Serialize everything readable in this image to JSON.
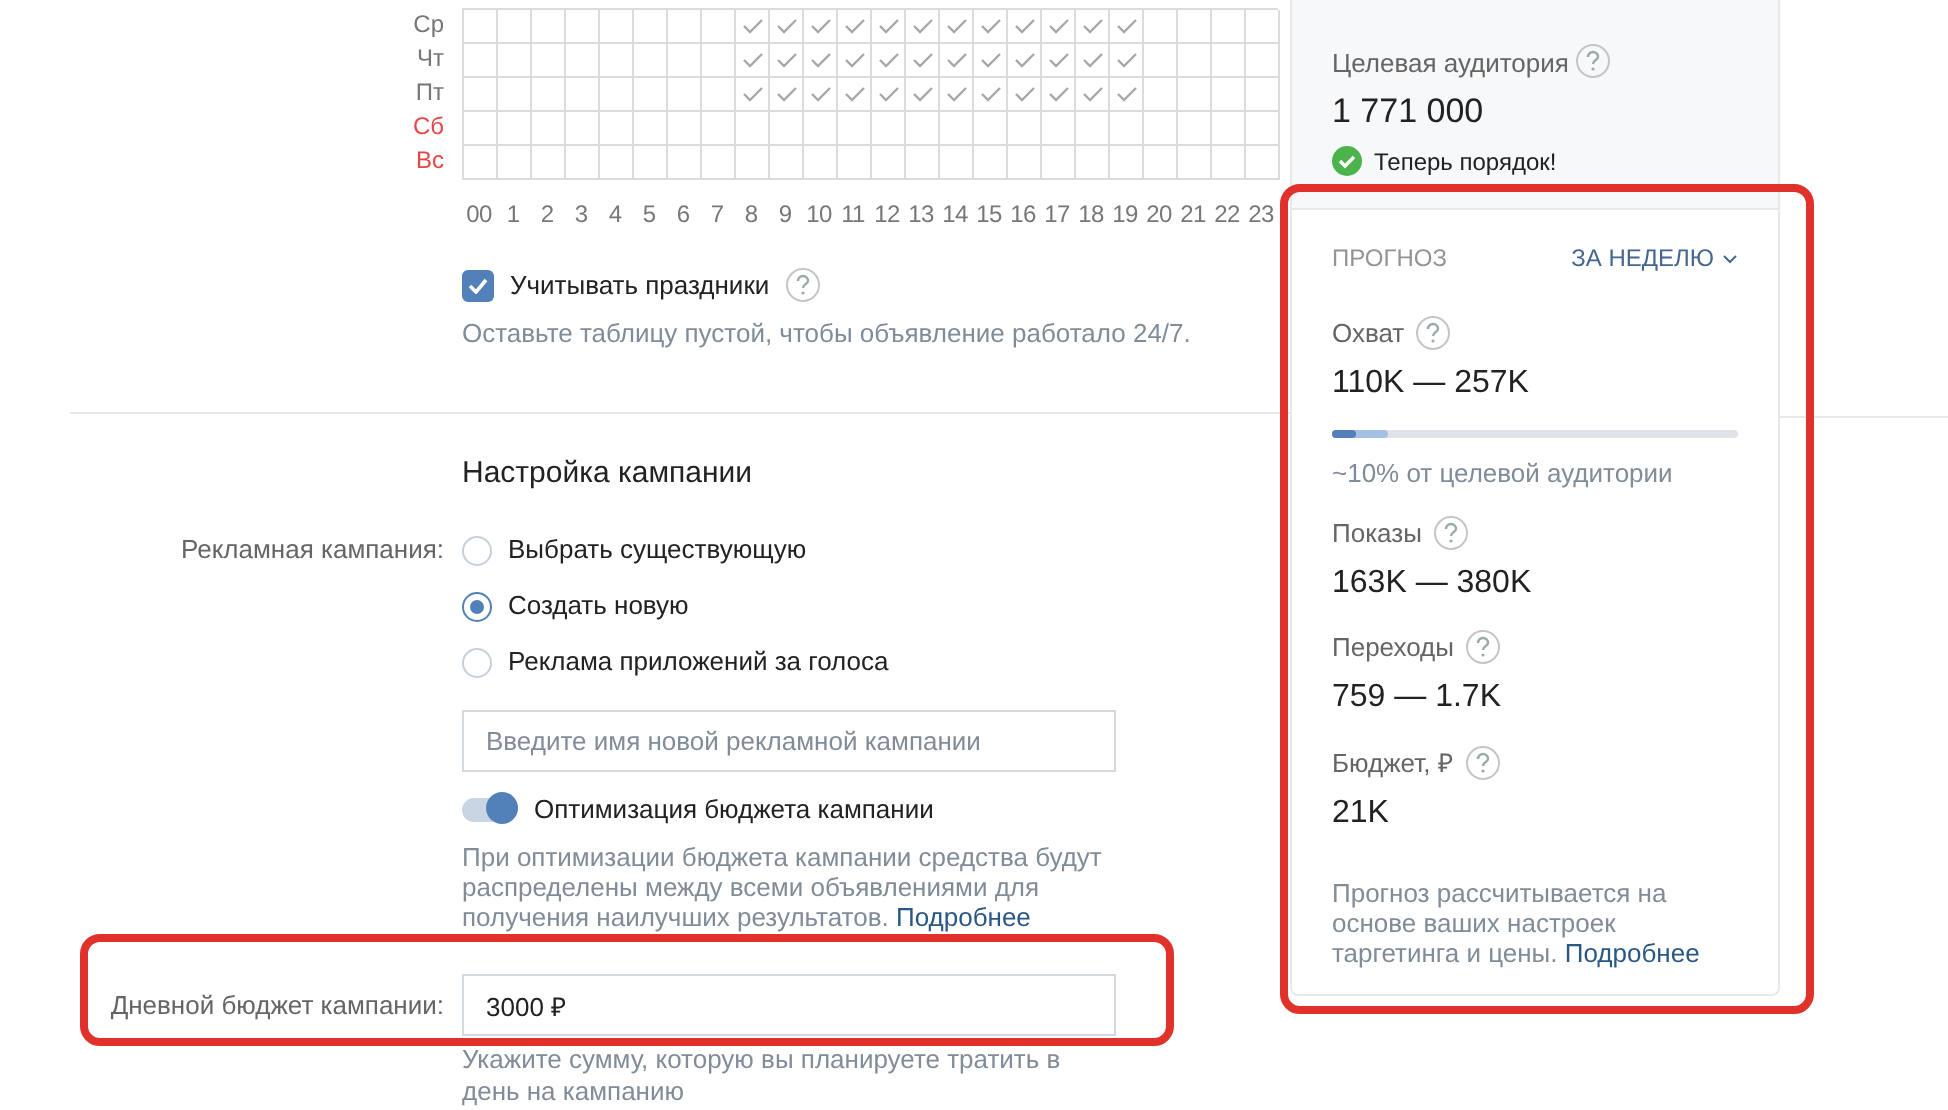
{
  "schedule": {
    "days": [
      {
        "label": "Ср",
        "weekend": false,
        "checked": [
          false,
          false,
          false,
          false,
          false,
          false,
          false,
          false,
          true,
          true,
          true,
          true,
          true,
          true,
          true,
          true,
          true,
          true,
          true,
          true,
          false,
          false,
          false,
          false
        ]
      },
      {
        "label": "Чт",
        "weekend": false,
        "checked": [
          false,
          false,
          false,
          false,
          false,
          false,
          false,
          false,
          true,
          true,
          true,
          true,
          true,
          true,
          true,
          true,
          true,
          true,
          true,
          true,
          false,
          false,
          false,
          false
        ]
      },
      {
        "label": "Пт",
        "weekend": false,
        "checked": [
          false,
          false,
          false,
          false,
          false,
          false,
          false,
          false,
          true,
          true,
          true,
          true,
          true,
          true,
          true,
          true,
          true,
          true,
          true,
          true,
          false,
          false,
          false,
          false
        ]
      },
      {
        "label": "Сб",
        "weekend": true,
        "checked": [
          false,
          false,
          false,
          false,
          false,
          false,
          false,
          false,
          false,
          false,
          false,
          false,
          false,
          false,
          false,
          false,
          false,
          false,
          false,
          false,
          false,
          false,
          false,
          false
        ]
      },
      {
        "label": "Вс",
        "weekend": true,
        "checked": [
          false,
          false,
          false,
          false,
          false,
          false,
          false,
          false,
          false,
          false,
          false,
          false,
          false,
          false,
          false,
          false,
          false,
          false,
          false,
          false,
          false,
          false,
          false,
          false
        ]
      }
    ],
    "hours": [
      "00",
      "1",
      "2",
      "3",
      "4",
      "5",
      "6",
      "7",
      "8",
      "9",
      "10",
      "11",
      "12",
      "13",
      "14",
      "15",
      "16",
      "17",
      "18",
      "19",
      "20",
      "21",
      "22",
      "23"
    ],
    "holidays": {
      "label": "Учитывать праздники",
      "checked": true
    },
    "hint": "Оставьте таблицу пустой, чтобы объявление работало 24/7."
  },
  "campaign": {
    "heading": "Настройка кампании",
    "label": "Рекламная кампания:",
    "options": [
      {
        "label": "Выбрать существующую",
        "selected": false
      },
      {
        "label": "Создать новую",
        "selected": true
      },
      {
        "label": "Реклама приложений за голоса",
        "selected": false
      }
    ],
    "name_field": {
      "placeholder": "Введите имя новой рекламной кампании"
    },
    "optimization": {
      "label": "Оптимизация бюджета кампании",
      "on": true
    },
    "optimization_hint": "При оптимизации бюджета кампании средства будут распределены между всеми объявлениями для получения наилучших результатов.",
    "optimization_link": "Подробнее",
    "budget_label": "Дневной бюджет кампании:",
    "budget_value": "3000 ₽",
    "budget_hint": "Укажите сумму, которую вы планируете тратить в день на кампанию"
  },
  "audience": {
    "label": "Целевая аудитория",
    "value": "1 771 000",
    "status": "Теперь порядок!"
  },
  "forecast": {
    "title": "ПРОГНОЗ",
    "period": "ЗА НЕДЕЛЮ",
    "metrics": [
      {
        "kind": "bar",
        "label": "Охват",
        "value": "110K — 257K",
        "segments": [
          {
            "level": 0.06
          },
          {
            "level": 0.14
          }
        ],
        "note": "~10% от целевой аудитории"
      },
      {
        "kind": "plain",
        "label": "Показы",
        "value": "163K — 380K"
      },
      {
        "kind": "plain",
        "label": "Переходы",
        "value": "759 — 1.7K"
      },
      {
        "kind": "plain",
        "label": "Бюджет, ₽",
        "value": "21K"
      }
    ],
    "note": "Прогноз рассчитывается на основе ваших настроек таргетинга и цены.",
    "link": "Подробнее"
  }
}
